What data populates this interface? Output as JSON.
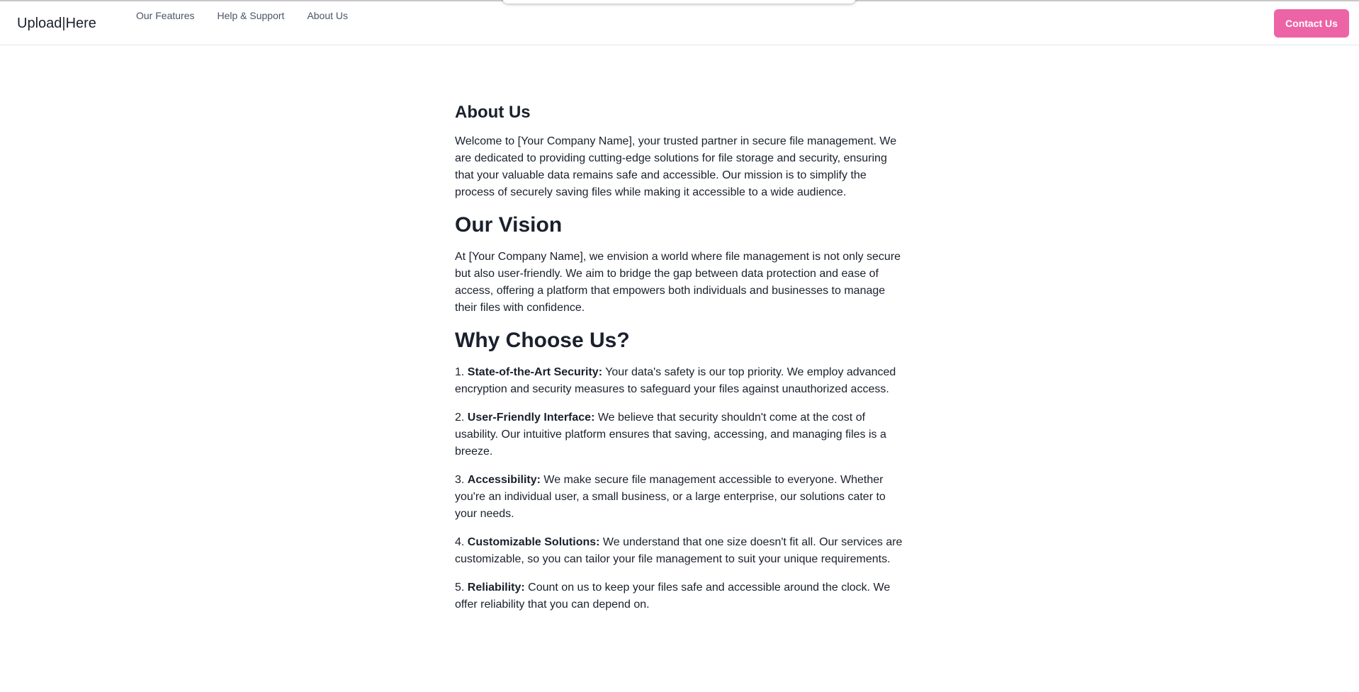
{
  "header": {
    "logo": "Upload|Here",
    "nav": [
      "Our Features",
      "Help & Support",
      "About Us"
    ],
    "contact_label": "Contact Us",
    "accent": "#ed64a6"
  },
  "main": {
    "about_title": "About Us",
    "about_text": "Welcome to [Your Company Name], your trusted partner in secure file management. We are dedicated to providing cutting-edge solutions for file storage and security, ensuring that your valuable data remains safe and accessible. Our mission is to simplify the process of securely saving files while making it accessible to a wide audience.",
    "vision_title": "Our Vision",
    "vision_text": "At [Your Company Name], we envision a world where file management is not only secure but also user-friendly. We aim to bridge the gap between data protection and ease of access, offering a platform that empowers both individuals and businesses to manage their files with confidence.",
    "why_title": "Why Choose Us?",
    "items": [
      {
        "num": "1.",
        "title": "State-of-the-Art Security:",
        "text": "Your data's safety is our top priority. We employ advanced encryption and security measures to safeguard your files against unauthorized access."
      },
      {
        "num": "2.",
        "title": "User-Friendly Interface:",
        "text": "We believe that security shouldn't come at the cost of usability. Our intuitive platform ensures that saving, accessing, and managing files is a breeze."
      },
      {
        "num": "3.",
        "title": "Accessibility:",
        "text": "We make secure file management accessible to everyone. Whether you're an individual user, a small business, or a large enterprise, our solutions cater to your needs."
      },
      {
        "num": "4.",
        "title": "Customizable Solutions:",
        "text": "We understand that one size doesn't fit all. Our services are customizable, so you can tailor your file management to suit your unique requirements."
      },
      {
        "num": "5.",
        "title": "Reliability:",
        "text": "Count on us to keep your files safe and accessible around the clock. We offer reliability that you can depend on."
      }
    ]
  }
}
